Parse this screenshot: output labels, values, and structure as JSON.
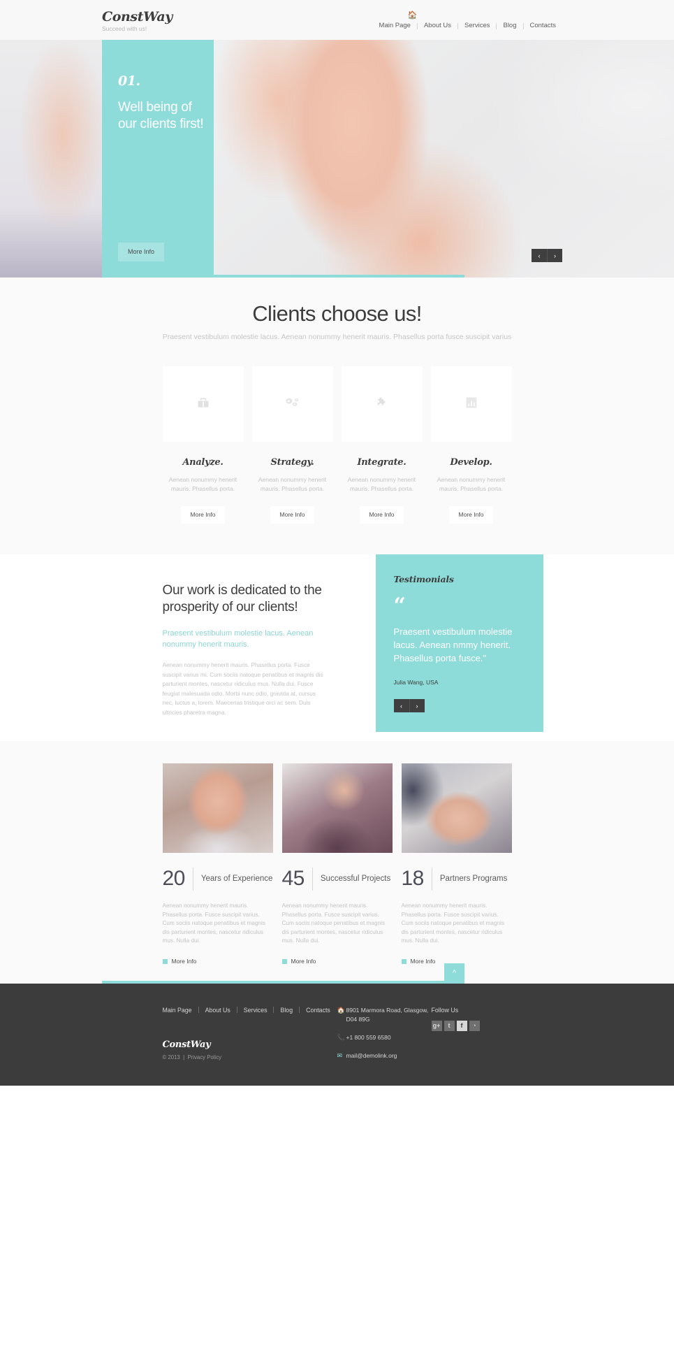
{
  "header": {
    "logo_name": "ConstWay",
    "logo_tagline": "Succeed with us!",
    "home_icon": "home-icon",
    "nav": [
      {
        "label": "Main Page"
      },
      {
        "label": "About Us"
      },
      {
        "label": "Services"
      },
      {
        "label": "Blog"
      },
      {
        "label": "Contacts"
      }
    ]
  },
  "hero": {
    "slide_number": "01.",
    "title": "Well being of our clients first!",
    "button_label": "More Info",
    "prev_label": "‹",
    "next_label": "›",
    "panel_color": "#8ddcd9"
  },
  "services": {
    "title": "Clients choose us!",
    "subtitle": "Praesent vestibulum molestie lacus. Aenean nonummy henerit mauris. Phasellus porta fusce suscipit varius",
    "cards": [
      {
        "icon": "briefcase-icon",
        "title": "Analyze.",
        "text": "Aenean nonummy henerit mauris. Phasellus porta.",
        "button_label": "More Info"
      },
      {
        "icon": "gears-icon",
        "title": "Strategy.",
        "text": "Aenean nonummy henerit mauris. Phasellus porta.",
        "button_label": "More Info"
      },
      {
        "icon": "puzzle-icon",
        "title": "Integrate.",
        "text": "Aenean nonummy henerit mauris. Phasellus porta.",
        "button_label": "More Info"
      },
      {
        "icon": "bar-chart-icon",
        "title": "Develop.",
        "text": "Aenean nonummy henerit mauris. Phasellus porta.",
        "button_label": "More Info"
      }
    ]
  },
  "about": {
    "heading": "Our work is dedicated to the prosperity of our clients!",
    "lead": "Praesent vestibulum molestie lacus. Aenean nonummy henerit mauris.",
    "body": "Aenean nonummy henerit mauris. Phasellus porta. Fusce suscipit varius mi. Cum sociis natoque penatibus et magnis dis parturient montes, nascetur ridiculus mus. Nulla dui. Fusce feugiat malesuada odio. Morbi nunc odio, gravida at, cursus nec, luctus a, lorem. Maecenas tristique orci ac sem. Duis ultricies pharetra magna."
  },
  "testimonials": {
    "heading": "Testimonials",
    "quote_mark": "“",
    "text": "Praesent vestibulum molestie lacus. Aenean nmmy henerit. Phasellus porta fusce.\"",
    "author": "Julia Wang, USA",
    "prev_label": "‹",
    "next_label": "›"
  },
  "stats": {
    "items": [
      {
        "photo": "smiling-businesswoman-photo",
        "number": "20",
        "label": "Years of Experience",
        "text": "Aenean nonummy henerit mauris. Phasellus porta. Fusce suscipit varius. Cum sociis natoque penatibus et magnis dis parturient montes, nascetur ridiculus mus. Nulla dui.",
        "link_label": "More Info"
      },
      {
        "photo": "celebrating-businessman-photo",
        "number": "45",
        "label": "Successful Projects",
        "text": "Aenean nonummy henerit mauris. Phasellus porta. Fusce suscipit varius. Cum sociis natoque penatibus et magnis dis parturient montes, nascetur ridiculus mus. Nulla dui.",
        "link_label": "More Info"
      },
      {
        "photo": "handshake-photo",
        "number": "18",
        "label": "Partners Programs",
        "text": "Aenean nonummy henerit mauris. Phasellus porta. Fusce suscipit varius. Cum sociis natoque penatibus et magnis dis parturient montes, nascetur ridiculus mus. Nulla dui.",
        "link_label": "More Info"
      }
    ],
    "to_top_label": "^"
  },
  "footer": {
    "nav": [
      {
        "label": "Main Page"
      },
      {
        "label": "About Us"
      },
      {
        "label": "Services"
      },
      {
        "label": "Blog"
      },
      {
        "label": "Contacts"
      }
    ],
    "logo_name": "ConstWay",
    "copyright": "© 2013",
    "privacy_label": "Privacy Policy",
    "address_icon": "home-icon",
    "address": "8901 Marmora Road, Glasgow, D04 89G",
    "phone_icon": "phone-icon",
    "phone": "+1 800 559 6580",
    "mail_icon": "envelope-icon",
    "email": "mail@demolink.org",
    "follow_label": "Follow Us",
    "social": [
      {
        "name": "google-plus-icon",
        "glyph": "g+"
      },
      {
        "name": "twitter-icon",
        "glyph": "t"
      },
      {
        "name": "facebook-icon",
        "glyph": "f"
      },
      {
        "name": "rss-icon",
        "glyph": "◔"
      }
    ]
  },
  "colors": {
    "accent": "#8ddcd9",
    "dark": "#3c3c3c",
    "text": "#3d3d3d",
    "muted": "#c4c4c4"
  }
}
